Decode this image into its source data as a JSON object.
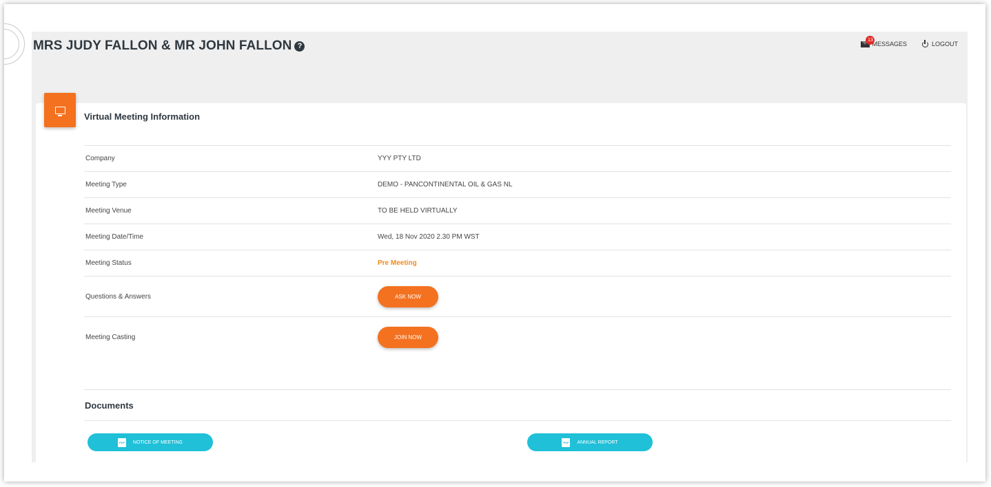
{
  "header": {
    "holder_name": "MRS JUDY FALLON & MR JOHN FALLON",
    "help_glyph": "?",
    "messages": {
      "label": "MESSAGES",
      "count": "13"
    },
    "logout_label": "LOGOUT"
  },
  "meeting_card": {
    "title": "Virtual Meeting Information",
    "rows": [
      {
        "label": "Company",
        "value": "YYY PTY LTD"
      },
      {
        "label": "Meeting Type",
        "value": "DEMO - PANCONTINENTAL OIL & GAS NL"
      },
      {
        "label": "Meeting Venue",
        "value": "TO BE HELD VIRTUALLY"
      },
      {
        "label": "Meeting Date/Time",
        "value": "Wed, 18 Nov 2020 2.30 PM WST"
      },
      {
        "label": "Meeting Status",
        "value": "Pre Meeting"
      },
      {
        "label": "Questions & Answers",
        "button": "ASK NOW"
      },
      {
        "label": "Meeting Casting",
        "button": "JOIN NOW"
      }
    ]
  },
  "documents": {
    "title": "Documents",
    "pdf_glyph": "PDF",
    "items": [
      {
        "label": "NOTICE OF MEETING"
      },
      {
        "label": "ANNUAL REPORT"
      }
    ]
  },
  "colors": {
    "accent_orange": "#f4711f",
    "status_orange": "#f08a1a",
    "doc_button_cyan": "#1fc0d8",
    "badge_red": "#e02b27",
    "page_background": "#efefef"
  },
  "icons": {
    "help": "question-circle-icon",
    "messages": "envelope-icon",
    "logout": "power-icon",
    "card": "monitor-icon",
    "document": "pdf-icon"
  }
}
